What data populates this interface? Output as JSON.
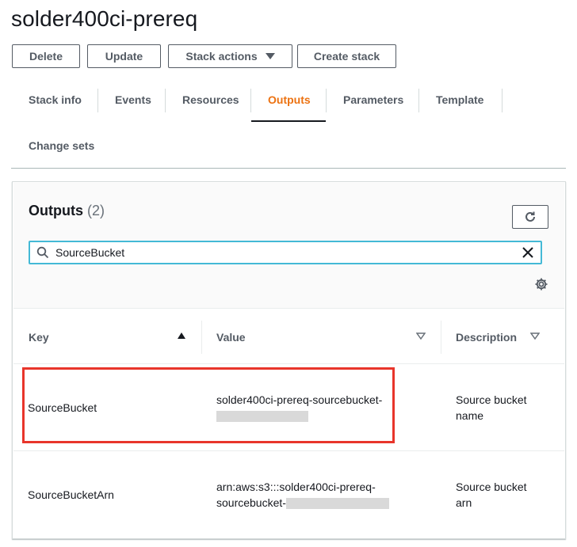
{
  "stack": {
    "title": "solder400ci-prereq"
  },
  "actions": {
    "delete": "Delete",
    "update": "Update",
    "stack_actions": "Stack actions",
    "create_stack": "Create stack"
  },
  "tabs": [
    {
      "label": "Stack info",
      "active": false
    },
    {
      "label": "Events",
      "active": false
    },
    {
      "label": "Resources",
      "active": false
    },
    {
      "label": "Outputs",
      "active": true
    },
    {
      "label": "Parameters",
      "active": false
    },
    {
      "label": "Template",
      "active": false
    },
    {
      "label": "Change sets",
      "active": false
    }
  ],
  "outputs": {
    "title": "Outputs",
    "count": "(2)",
    "search": {
      "value": "SourceBucket",
      "placeholder": ""
    },
    "columns": [
      "Key",
      "Value",
      "Description"
    ],
    "key_sort": "ascending",
    "rows": [
      {
        "key": "SourceBucket",
        "value_line1": "solder400ci-prereq-sourcebucket-",
        "value_line2": "",
        "value_redacted": true,
        "description_line1": "Source bucket",
        "description_line2": "name",
        "highlighted": true
      },
      {
        "key": "SourceBucketArn",
        "value_line1": "arn:aws:s3:::solder400ci-prereq-",
        "value_line2": "sourcebucket-",
        "value_redacted": true,
        "description_line1": "Source bucket",
        "description_line2": "arn",
        "highlighted": false
      }
    ]
  },
  "icons": {
    "refresh": "refresh-icon",
    "search": "search-icon",
    "clear": "close-icon",
    "settings": "gear-icon",
    "sort_asc": "sort-ascending-icon",
    "sort_desc": "sort-descending-icon",
    "caret": "caret-down-icon"
  },
  "colors": {
    "accent": "#ec7211",
    "focus": "#44b9d6",
    "highlight": "#e8352b",
    "text": "#16191f",
    "muted": "#545b64"
  }
}
